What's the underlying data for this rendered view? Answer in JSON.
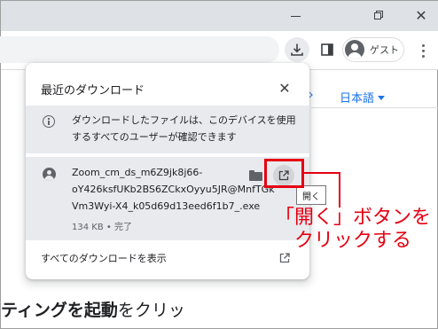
{
  "browser": {
    "profile_label": "ゲスト"
  },
  "page": {
    "language_link": "日本語",
    "body_text_bold": "ティングを起動",
    "body_text_rest": "をクリッ"
  },
  "downloads_bubble": {
    "title": "最近のダウンロード",
    "notice": "ダウンロードしたファイルは、このデバイスを使用するすべてのユーザーが確認できます",
    "item": {
      "filename": "Zoom_cm_ds_m6Z9jk8j66-oY426ksfUKb2BS6ZCkxOyyu5JR@MnfTGkVm3Wyi-X4_k05d69d13eed6f1b7_.exe",
      "meta": "134 KB • 完了"
    },
    "show_all": "すべてのダウンロードを表示",
    "tooltip": "開く"
  },
  "annotation": {
    "text": "「開く」ボタンをクリックする",
    "color": "#e60012"
  },
  "colors": {
    "accent": "#1a73e8",
    "titlebar": "#dee1e6",
    "item_background": "#e8eaed"
  }
}
